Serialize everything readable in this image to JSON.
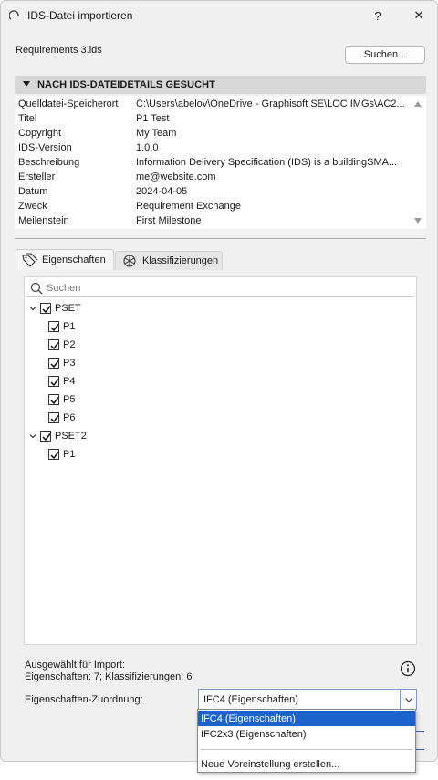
{
  "window": {
    "title": "IDS-Datei importieren",
    "help_label": "?",
    "close_label": "✕"
  },
  "file": {
    "name": "Requirements 3.ids",
    "search_button": "Suchen..."
  },
  "details": {
    "section_title": "NACH IDS-DATEIDETAILS GESUCHT",
    "rows": [
      {
        "label": "Quelldatei-Speicherort",
        "value": "C:\\Users\\abelov\\OneDrive - Graphisoft SE\\LOC IMGs\\AC2..."
      },
      {
        "label": "Titel",
        "value": "P1 Test"
      },
      {
        "label": "Copyright",
        "value": "My Team"
      },
      {
        "label": "IDS-Version",
        "value": "1.0.0"
      },
      {
        "label": "Beschreibung",
        "value": "Information Delivery Specification (IDS) is a buildingSMA..."
      },
      {
        "label": "Ersteller",
        "value": "me@website.com"
      },
      {
        "label": "Datum",
        "value": "2024-04-05"
      },
      {
        "label": "Zweck",
        "value": "Requirement Exchange"
      },
      {
        "label": "Meilenstein",
        "value": "First Milestone"
      }
    ]
  },
  "tabs": [
    {
      "label": "Eigenschaften",
      "icon": "tag-icon",
      "active": true
    },
    {
      "label": "Klassifizierungen",
      "icon": "classification-icon",
      "active": false
    }
  ],
  "tree": {
    "search_placeholder": "Suchen",
    "groups": [
      {
        "label": "PSET",
        "checked": true,
        "expanded": true,
        "items": [
          "P1",
          "P2",
          "P3",
          "P4",
          "P5",
          "P6"
        ]
      },
      {
        "label": "PSET2",
        "checked": true,
        "expanded": true,
        "items": [
          "P1"
        ]
      }
    ]
  },
  "import_info": {
    "line1": "Ausgewählt für Import:",
    "line2": "Eigenschaften: 7; Klassifizierungen: 6"
  },
  "mapping": {
    "label": "Eigenschaften-Zuordnung:",
    "selected": "IFC4 (Eigenschaften)",
    "options": [
      "IFC4 (Eigenschaften)",
      "IFC2x3 (Eigenschaften)"
    ],
    "new_preset": "Neue Voreinstellung erstellen..."
  },
  "colors": {
    "accent": "#1c62cc",
    "window_bg": "#f0f0f0",
    "section_header_bg": "#d7d7d7"
  }
}
